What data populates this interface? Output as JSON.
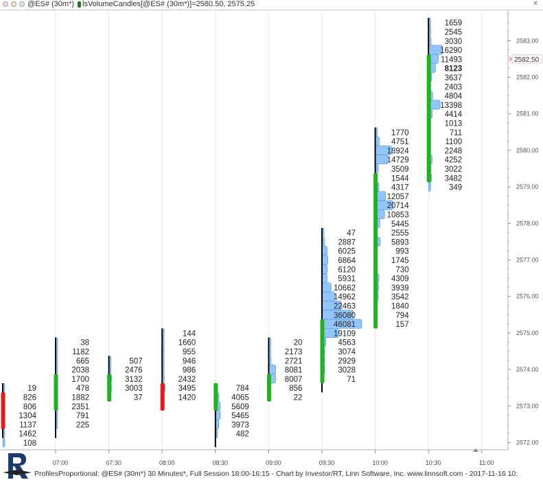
{
  "titlebar": {
    "symbol": "@ES# (30m*)",
    "study": "lsVolumeCandles[@ES# (30m*)]=2580.50, 2575.25",
    "close_glyph": "×"
  },
  "price_marker": "2582.50",
  "footer": "ProfilesProportional: @ES# (30m*) 30 Minutes*, Full Session 18:00-16:15 - Chart by Investor/RT, Linn Software, Inc. www.linnsoft.com - 2017-11-16 10:",
  "colors": {
    "profile_fill": "#92c5fa",
    "profile_edge": "#4f8fd6",
    "up": "#1fb31f",
    "down": "#e01b1b",
    "wick": "#000000",
    "vline": "#e9e9e9"
  },
  "icons": [
    "investor-rt-logo",
    "close-icon",
    "price-marker-arrow-icon"
  ],
  "chart_data": {
    "type": "volume-profile-candles",
    "y_axis": {
      "min": 2571.75,
      "max": 2583.75,
      "side": "right",
      "ticks": [
        "2572.00",
        "2573.00",
        "2574.00",
        "2575.00",
        "2576.00",
        "2577.00",
        "2578.00",
        "2579.00",
        "2580.00",
        "2581.00",
        "2582.00",
        "2583.00"
      ]
    },
    "x_axis": {
      "ticks": [
        "07:00",
        "07:30",
        "08:00",
        "08:30",
        "09:00",
        "09:30",
        "10:00",
        "10:30",
        "11:00"
      ]
    },
    "tick_size": 0.25,
    "bars": [
      {
        "time": "",
        "open": 2573.25,
        "close": 2572.5,
        "high": 2573.5,
        "low": 2572.25,
        "volumes": [
          19,
          826,
          806,
          1304,
          1137,
          1462,
          108
        ]
      },
      {
        "time": "07:00",
        "open": 2573.0,
        "close": 2573.75,
        "high": 2574.75,
        "low": 2572.25,
        "volumes": [
          38,
          1182,
          665,
          2038,
          1700,
          478,
          1882,
          2351,
          791,
          225
        ]
      },
      {
        "time": "07:30",
        "open": 2573.25,
        "close": 2573.75,
        "high": 2574.25,
        "low": 2573.25,
        "volumes": [
          507,
          2476,
          3132,
          3003,
          37
        ]
      },
      {
        "time": "08:00",
        "open": 2573.5,
        "close": 2573.0,
        "high": 2575.0,
        "low": 2573.0,
        "volumes": [
          144,
          1660,
          955,
          946,
          986,
          2432,
          3495,
          1420
        ]
      },
      {
        "time": "08:30",
        "open": 2573.0,
        "close": 2573.5,
        "high": 2573.5,
        "low": 2572.0,
        "volumes": [
          784,
          4065,
          5609,
          5465,
          3973,
          482
        ]
      },
      {
        "time": "09:00",
        "open": 2573.25,
        "close": 2573.75,
        "high": 2574.75,
        "low": 2573.25,
        "volumes": [
          20,
          2173,
          2721,
          8081,
          8007,
          856,
          22
        ]
      },
      {
        "time": "09:30",
        "open": 2573.75,
        "close": 2575.25,
        "high": 2577.75,
        "low": 2573.5,
        "volumes": [
          47,
          2887,
          6025,
          6864,
          6120,
          5931,
          10662,
          14962,
          22463,
          36080,
          46081,
          19109,
          4563,
          3074,
          2929,
          3028,
          71
        ]
      },
      {
        "time": "10:00",
        "open": 2575.25,
        "close": 2579.25,
        "high": 2580.5,
        "low": 2575.25,
        "volumes": [
          1770,
          4751,
          18924,
          14729,
          3509,
          1544,
          4317,
          12057,
          20714,
          10853,
          5445,
          2555,
          5893,
          993,
          1745,
          730,
          4309,
          3939,
          3542,
          1840,
          794,
          157
        ]
      },
      {
        "time": "10:30",
        "open": 2579.25,
        "close": 2582.5,
        "high": 2583.5,
        "low": 2579.25,
        "volumes": [
          1659,
          2545,
          3030,
          16290,
          11493,
          8123,
          3637,
          2403,
          4804,
          13398,
          4414,
          1013,
          711,
          1100,
          2248,
          4252,
          3022,
          3482,
          349
        ]
      }
    ],
    "bold_volume": 8123,
    "grid": "vertical only"
  }
}
